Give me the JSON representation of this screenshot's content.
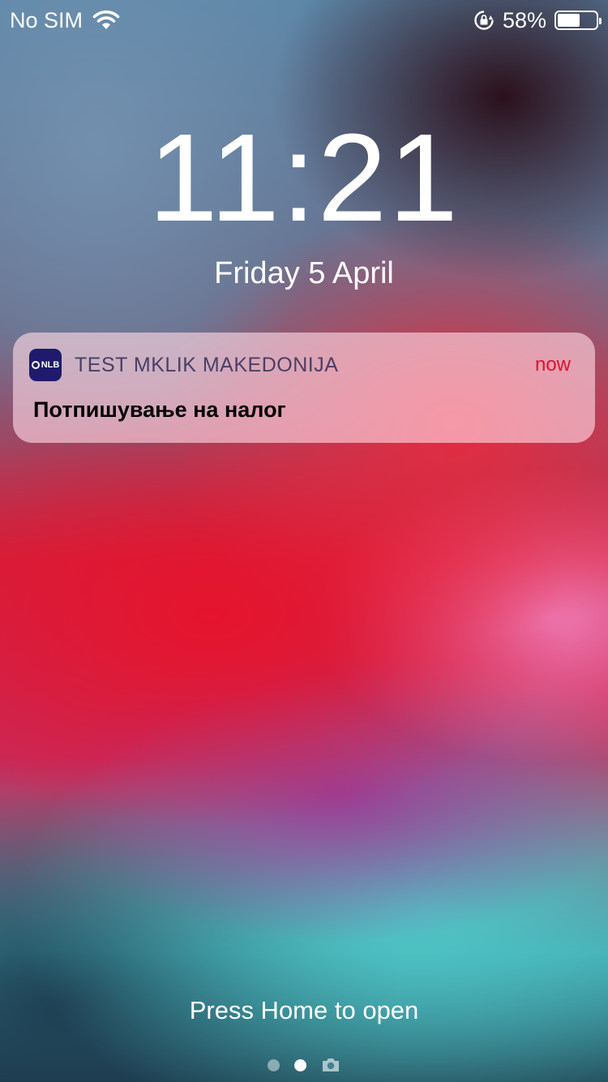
{
  "status_bar": {
    "carrier": "No SIM",
    "battery_percent": "58%",
    "battery_level": 0.58,
    "icons": [
      "wifi-icon",
      "orientation-lock-icon",
      "battery-icon"
    ]
  },
  "lock_screen": {
    "time": "11:21",
    "date": "Friday 5 April"
  },
  "notification": {
    "app_icon_text": "NLB",
    "app_name": "TEST MKLIK MAKEDONIJA",
    "time": "now",
    "body": "Потпишување на налог"
  },
  "footer": {
    "press_home": "Press Home to open",
    "pages": 2,
    "active_page": 1,
    "camera_icon": "camera-icon"
  },
  "colors": {
    "notification_time": "#e01030",
    "app_icon_bg": "#1f1a6b"
  }
}
